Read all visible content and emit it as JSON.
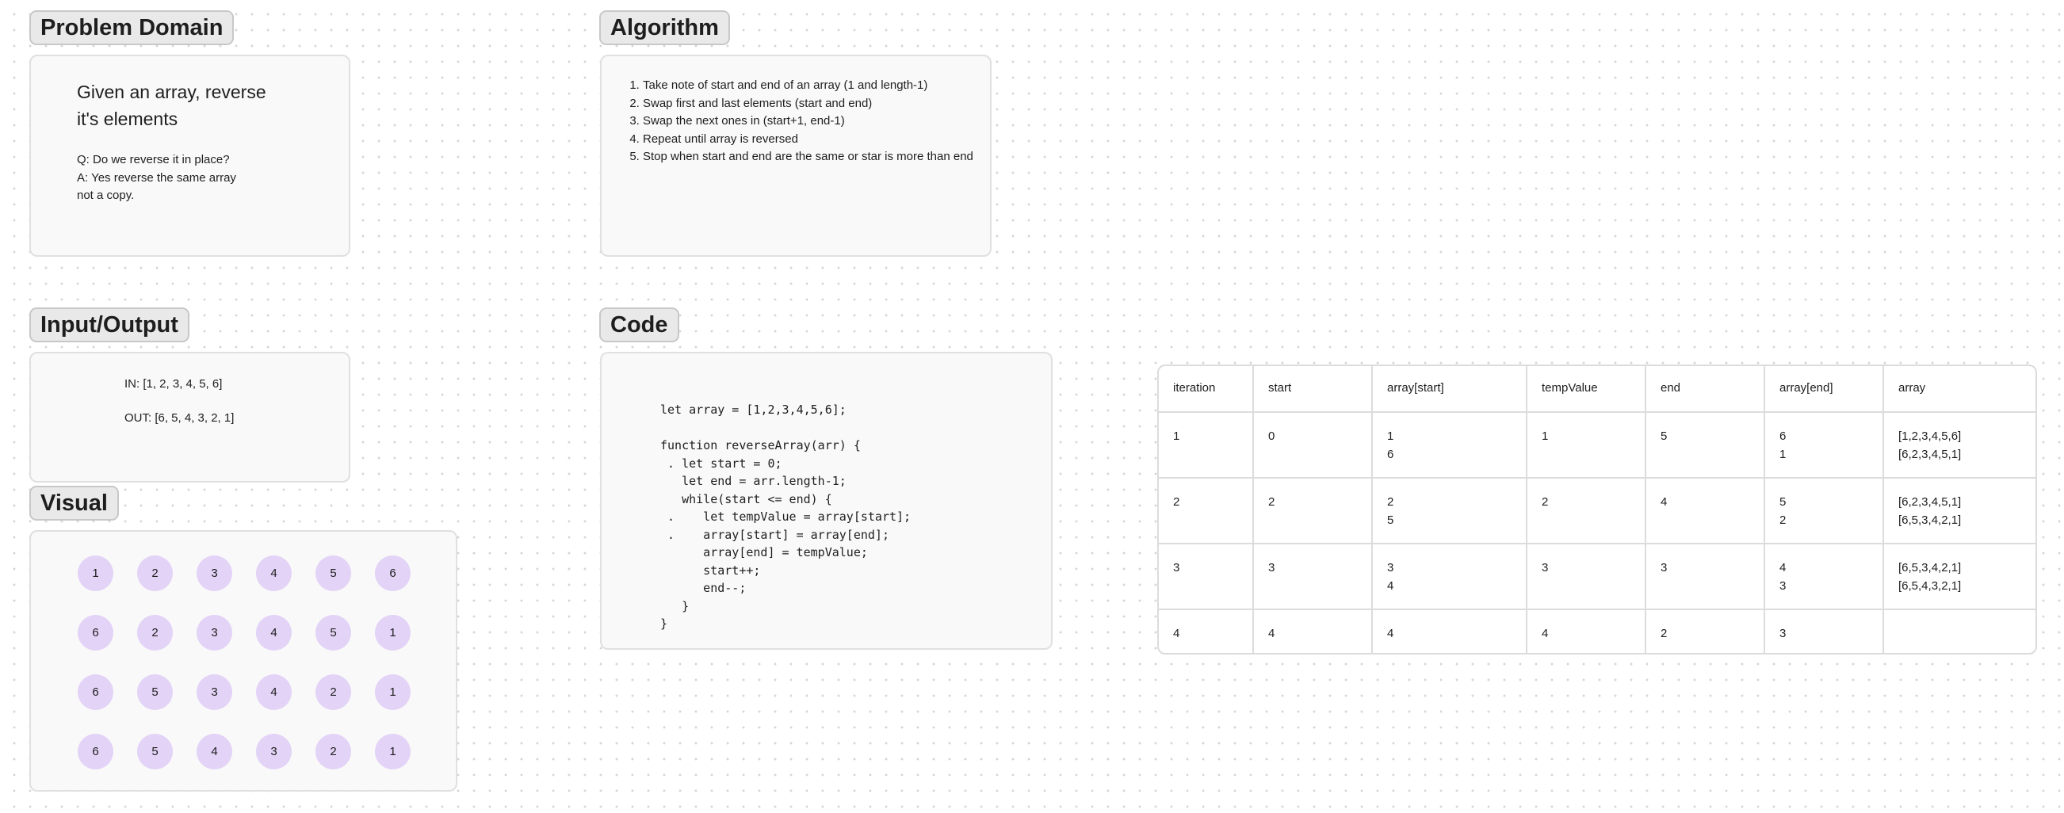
{
  "problem_domain": {
    "title": "Problem Domain",
    "statement_lines": [
      "Given an array, reverse",
      "it's elements"
    ],
    "qa_lines": [
      "Q: Do we reverse it in place?",
      "A: Yes reverse the same array",
      "not a copy."
    ]
  },
  "algorithm": {
    "title": "Algorithm",
    "steps": [
      "Take note of start and end of an array (1 and length-1)",
      "Swap first and last elements (start and end)",
      "Swap the next ones in (start+1, end-1)",
      "Repeat until array is reversed",
      "Stop when start and end are the same or star is more than end"
    ]
  },
  "input_output": {
    "title": "Input/Output",
    "input": "IN: [1, 2, 3, 4, 5, 6]",
    "output": "OUT: [6, 5, 4, 3, 2, 1]"
  },
  "code": {
    "title": "Code",
    "source": "let array = [1,2,3,4,5,6];\n\nfunction reverseArray(arr) {\n . let start = 0;\n   let end = arr.length-1;\n   while(start <= end) {\n .    let tempValue = array[start];\n .    array[start] = array[end];\n      array[end] = tempValue;\n      start++;\n      end--;\n   }\n}"
  },
  "visual": {
    "title": "Visual",
    "rows": [
      [
        "1",
        "2",
        "3",
        "4",
        "5",
        "6"
      ],
      [
        "6",
        "2",
        "3",
        "4",
        "5",
        "1"
      ],
      [
        "6",
        "5",
        "3",
        "4",
        "2",
        "1"
      ],
      [
        "6",
        "5",
        "4",
        "3",
        "2",
        "1"
      ]
    ]
  },
  "trace_table": {
    "headers": [
      "iteration",
      "start",
      "array[start]",
      "tempValue",
      "end",
      "array[end]",
      "array"
    ],
    "rows": [
      {
        "iteration": "1",
        "start": "0",
        "array_start": [
          "1",
          "6"
        ],
        "temp_value": "1",
        "end": "5",
        "array_end": [
          "6",
          "1"
        ],
        "array": [
          "[1,2,3,4,5,6]",
          "[6,2,3,4,5,1]"
        ]
      },
      {
        "iteration": "2",
        "start": "2",
        "array_start": [
          "2",
          "5"
        ],
        "temp_value": "2",
        "end": "4",
        "array_end": [
          "5",
          "2"
        ],
        "array": [
          "[6,2,3,4,5,1]",
          "[6,5,3,4,2,1]"
        ]
      },
      {
        "iteration": "3",
        "start": "3",
        "array_start": [
          "3",
          "4"
        ],
        "temp_value": "3",
        "end": "3",
        "array_end": [
          "4",
          "3"
        ],
        "array": [
          "[6,5,3,4,2,1]",
          "[6,5,4,3,2,1]"
        ]
      },
      {
        "iteration": "4",
        "start": "4",
        "array_start": [
          "4"
        ],
        "temp_value": "4",
        "end": "2",
        "array_end": [
          "3"
        ],
        "array": []
      }
    ]
  },
  "colors": {
    "circle_fill": "#e3d3f7",
    "card_background": "#f9f9f9",
    "label_background": "#e9e9e9"
  }
}
